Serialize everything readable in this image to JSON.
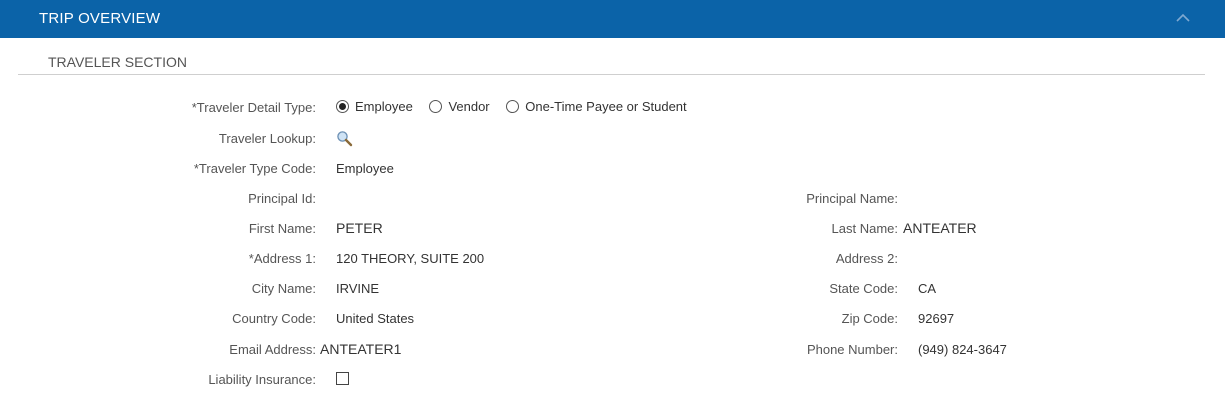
{
  "header": {
    "title": "TRIP OVERVIEW",
    "collapse_icon": "chevron-up-icon"
  },
  "section": {
    "title": "TRAVELER SECTION"
  },
  "traveler_detail_type": {
    "label": "*Traveler Detail Type:",
    "options": [
      "Employee",
      "Vendor",
      "One-Time Payee or Student"
    ],
    "selected": "Employee"
  },
  "traveler_lookup": {
    "label": "Traveler Lookup:",
    "icon": "search-icon"
  },
  "traveler_type_code": {
    "label": "*Traveler Type Code:",
    "value": "Employee"
  },
  "principal_id": {
    "label": "Principal Id:",
    "value": ""
  },
  "principal_name": {
    "label": "Principal Name:",
    "value": ""
  },
  "first_name": {
    "label": "First Name:",
    "value": "PETER"
  },
  "last_name": {
    "label": "Last Name:",
    "value": "ANTEATER"
  },
  "address1": {
    "label": "*Address 1:",
    "value": "120 THEORY, SUITE 200"
  },
  "address2": {
    "label": "Address 2:",
    "value": ""
  },
  "city": {
    "label": "City Name:",
    "value": "IRVINE"
  },
  "state": {
    "label": "State Code:",
    "value": "CA"
  },
  "country": {
    "label": "Country Code:",
    "value": "United States"
  },
  "zip": {
    "label": "Zip Code:",
    "value": "92697"
  },
  "email": {
    "label": "Email Address:",
    "value": "ANTEATER1"
  },
  "phone": {
    "label": "Phone Number:",
    "value": "(949) 824-3647"
  },
  "liability": {
    "label": "Liability Insurance:",
    "checked": false
  },
  "colors": {
    "header_bg": "#0b63a8",
    "header_text": "#ffffff",
    "rule": "#cfcfcf"
  }
}
